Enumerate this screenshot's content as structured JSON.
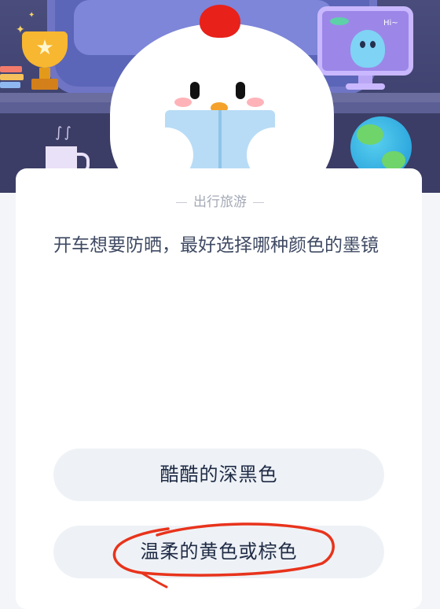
{
  "header": {
    "monitor_greeting": "Hi~"
  },
  "question_card": {
    "category": "出行旅游",
    "question": "开车想要防晒，最好选择哪种颜色的墨镜",
    "options": [
      {
        "label": "酷酷的深黑色"
      },
      {
        "label": "温柔的黄色或棕色"
      }
    ]
  },
  "colors": {
    "page_background": "#f4f5f9",
    "card_background": "#ffffff",
    "option_background": "#eef2f6",
    "question_text": "#3f4a63",
    "category_text": "#a4a9b6",
    "annotation_stroke": "#e8331c"
  },
  "icons": {
    "mascot": "chick-reading-icon",
    "trophy": "trophy-icon",
    "globe": "globe-icon",
    "alien": "alien-icon",
    "mug": "mug-icon"
  }
}
